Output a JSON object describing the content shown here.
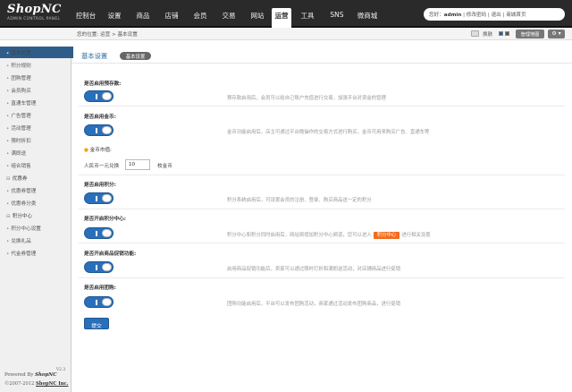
{
  "logo": {
    "main": "ShopNC",
    "sub": "ADMIN CONTROL PANEL"
  },
  "nav": [
    "控制台",
    "设置",
    "商品",
    "店铺",
    "会员",
    "交易",
    "网站",
    "运营",
    "工具",
    "SNS",
    "微商城"
  ],
  "nav_active_index": 7,
  "user": {
    "greeting": "您好：",
    "name": "admin",
    "links": "| 修改密码 | 退出 | 商城首页"
  },
  "breadcrumb": "您的位置: 运营 > 基本设置",
  "toolbar": {
    "skin_label": "换肤",
    "admin_map_label": "管理地图",
    "gear_label": "⚙ ▾"
  },
  "sidebar": {
    "items": [
      {
        "label": "基本设置",
        "active": true,
        "group": true
      },
      {
        "label": "积分规则"
      },
      {
        "label": "团购管理"
      },
      {
        "label": "会员购买"
      },
      {
        "label": "直通车管理"
      },
      {
        "label": "广告管理"
      },
      {
        "label": "活动管理"
      },
      {
        "label": "限时折扣"
      },
      {
        "label": "满即送"
      },
      {
        "label": "组合销售"
      },
      {
        "label": "优惠券",
        "group": true
      },
      {
        "label": "优惠券管理"
      },
      {
        "label": "优惠券分类"
      },
      {
        "label": "积分中心",
        "group": true
      },
      {
        "label": "积分中心设置"
      },
      {
        "label": "兑换礼品"
      },
      {
        "label": "代金券管理"
      }
    ],
    "powered_prefix": "Powered By ",
    "powered_brand": "ShopNC",
    "version": "V2.3",
    "copyright_prefix": "©2007-2012 ",
    "copyright_brand": "ShopNC Inc."
  },
  "main": {
    "title": "基本设置",
    "tab": "基本设置",
    "settings": [
      {
        "label": "是否启用预存款:",
        "desc": "预存款启用后，会员可以给自己账户充值进行交易，加强平台对资金的管理",
        "enabled": true
      },
      {
        "label": "是否启用金币:",
        "desc": "金币功能启用后，店主可通过平台微操作的交易方式进行购买，金币可用来购买广告、直通车等",
        "enabled": true
      },
      {
        "label": "是否启用积分:",
        "desc": "积分系统启用后，可设置会员的注册、登录、购买商品送一定的积分",
        "enabled": true
      },
      {
        "label": "是否开启积分中心:",
        "desc_before": "积分中心和积分同时启用后，网站将增加积分中心频道，您可以进入",
        "desc_tag": "积分中心",
        "desc_after": "进行相关设置",
        "enabled": true
      },
      {
        "label": "是否开启商品促销功能:",
        "desc": "启用商品促销功能后，卖家可以通过限时打折和满即送活动，对店铺商品进行促销",
        "enabled": true
      },
      {
        "label": "是否启用团购:",
        "desc": "团购功能启用后，平台可以发布团购活动，商家通过活动发布团购商品，进行促销",
        "enabled": true
      }
    ],
    "gold_rate": {
      "title": "金币市值:",
      "prefix": "人民币一元兑换",
      "value": "10",
      "unit": "枚金币"
    },
    "submit_label": "提交"
  }
}
